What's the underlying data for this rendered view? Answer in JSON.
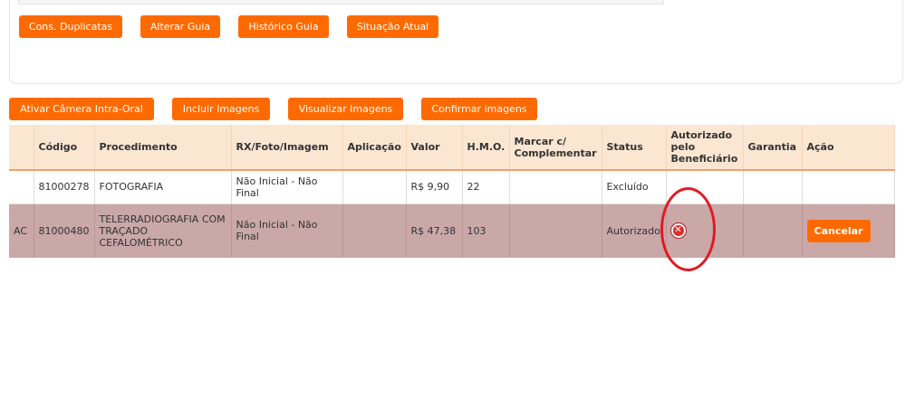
{
  "top_buttons": [
    "Cons. Duplicatas",
    "Alterar Guia",
    "Histórico Guia",
    "Situação Atual"
  ],
  "image_buttons": [
    "Ativar Câmera Intra-Oral",
    "Incluir Imagens",
    "Visualizar Imagens",
    "Confirmar imagens"
  ],
  "table": {
    "headers": [
      "",
      "Código",
      "Procedimento",
      "RX/Foto/Imagem",
      "Aplicação",
      "Valor",
      "H.M.O.",
      "Marcar c/ Complementar",
      "Status",
      "Autorizado pelo Beneficiário",
      "Garantia",
      "Ação"
    ],
    "rows": [
      {
        "flag": "",
        "codigo": "81000278",
        "procedimento": "FOTOGRAFIA",
        "rx": "Não Inicial - Não Final",
        "aplicacao": "",
        "valor": "R$ 9,90",
        "hmo": "22",
        "complementar": "",
        "status": "Excluído",
        "garantia": ""
      },
      {
        "flag": "AC",
        "codigo": "81000480",
        "procedimento": "TELERRADIOGRAFIA COM TRAÇADO CEFALOMÉTRICO",
        "rx": "Não Inicial - Não Final",
        "aplicacao": "",
        "valor": "R$ 47,38",
        "hmo": "103",
        "complementar": "",
        "status": "Autorizado",
        "autorizado_icon": "close-circle-icon",
        "garantia": "",
        "acao": "Cancelar"
      }
    ]
  },
  "colors": {
    "accent": "#ff6a00",
    "header_bg": "#fbe6d2",
    "selected_row": "#caa8a8",
    "annotation": "#e01b22"
  }
}
